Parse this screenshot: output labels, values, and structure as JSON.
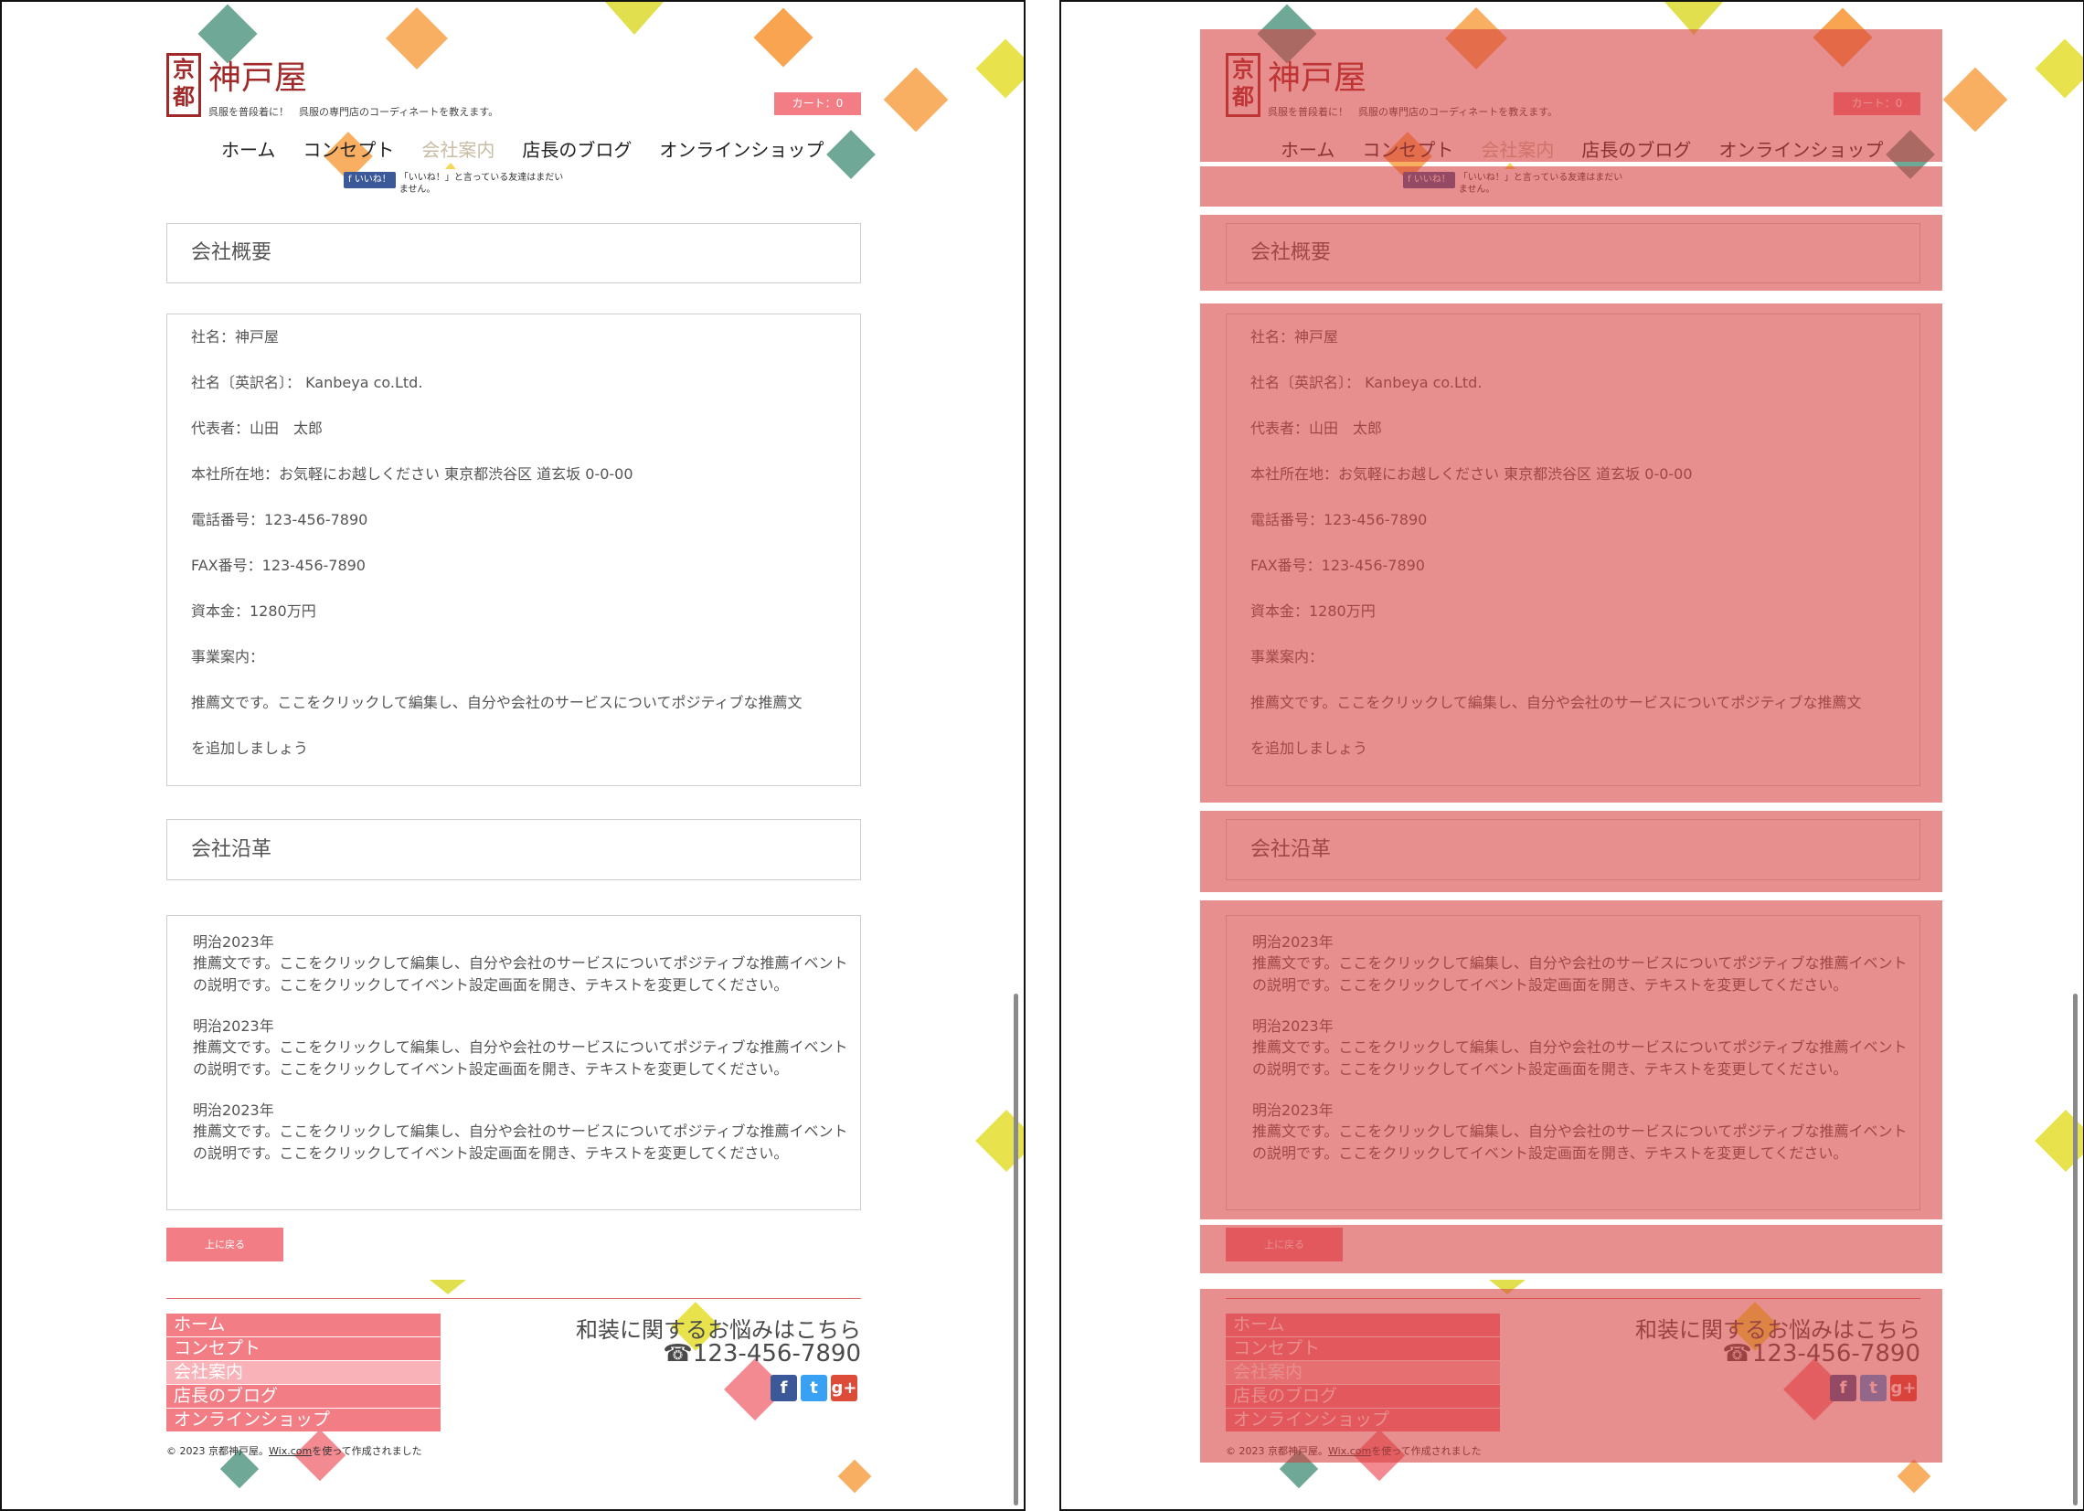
{
  "site": {
    "logo_stamp": [
      "京",
      "都"
    ],
    "logo_name": "神戸屋",
    "tagline": "呉服を普段着に！　呉服の専門店のコーディネートを教えます。",
    "cart": "カート：0"
  },
  "nav": [
    "ホーム",
    "コンセプト",
    "会社案内",
    "店長のブログ",
    "オンラインショップ"
  ],
  "nav_active": "会社案内",
  "facebook": {
    "button": "いいね！",
    "text": "「いいね！」と言っている友達はまだいません。"
  },
  "company_title": "会社概要",
  "company_info": [
    "社名：神戸屋",
    "社名〔英訳名〕：  Kanbeya co.Ltd.",
    "代表者：山田　太郎",
    "本社所在地：お気軽にお越しください 東京都渋谷区 道玄坂 0-0-00",
    "電話番号：123-456-7890",
    "FAX番号：123-456-7890",
    "資本金：1280万円",
    "事業案内：",
    "推薦文です。ここをクリックして編集し、自分や会社のサービスについてポジティブな推薦文",
    "を追加しましょう"
  ],
  "history_title": "会社沿革",
  "history": [
    {
      "year": "明治2023年",
      "desc": "推薦文です。ここをクリックして編集し、自分や会社のサービスについてポジティブな推薦イベントの説明です。ここをクリックしてイベント設定画面を開き、テキストを変更してください。"
    },
    {
      "year": "明治2023年",
      "desc": "推薦文です。ここをクリックして編集し、自分や会社のサービスについてポジティブな推薦イベントの説明です。ここをクリックしてイベント設定画面を開き、テキストを変更してください。"
    },
    {
      "year": "明治2023年",
      "desc": "推薦文です。ここをクリックして編集し、自分や会社のサービスについてポジティブな推薦イベントの説明です。ここをクリックしてイベント設定画面を開き、テキストを変更してください。"
    }
  ],
  "back_to_top": "上に戻る",
  "footer": {
    "nav": [
      "ホーム",
      "コンセプト",
      "会社案内",
      "店長のブログ",
      "オンラインショップ"
    ],
    "contact_title": "和装に関するお悩みはこちら",
    "phone": "☎123-456-7890",
    "social": [
      {
        "icon": "facebook-icon",
        "glyph": "f",
        "color": "#3b5998"
      },
      {
        "icon": "twitter-icon",
        "glyph": "t",
        "color": "#38a1f3"
      },
      {
        "icon": "google-plus-icon",
        "glyph": "g+",
        "color": "#dd4b39"
      }
    ],
    "copyright_pre": "© 2023 京都神戸屋。",
    "copyright_link": "Wix.com",
    "copyright_post": "を使って作成されました"
  },
  "colors": {
    "accent": "#f27d85",
    "brand": "#a02a2a",
    "overlay": "#d63e3e"
  }
}
